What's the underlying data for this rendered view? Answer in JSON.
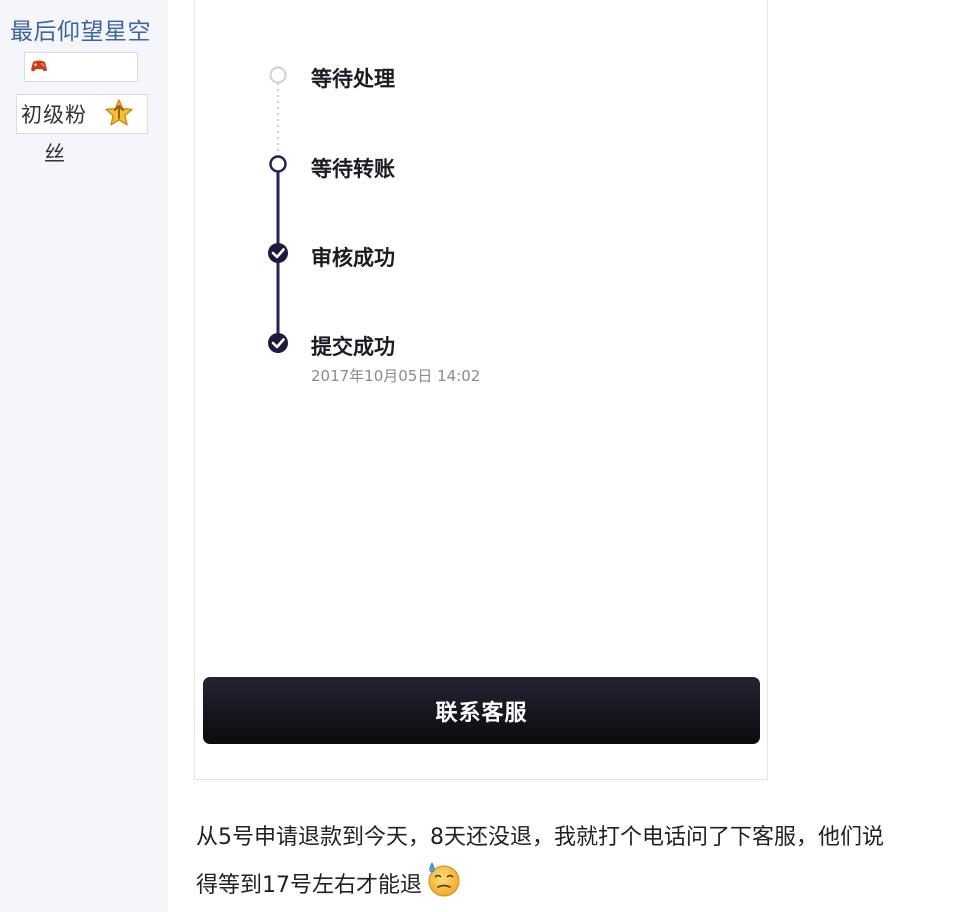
{
  "sidebar": {
    "username": "最后仰望星空",
    "level_label_line1": "初级粉",
    "level_label_line2": "丝"
  },
  "timeline": {
    "steps": [
      {
        "label": "等待处理",
        "status": "pending"
      },
      {
        "label": "等待转账",
        "status": "current"
      },
      {
        "label": "审核成功",
        "status": "done"
      },
      {
        "label": "提交成功",
        "status": "done",
        "time": "2017年10月05日 14:02"
      }
    ]
  },
  "actions": {
    "contact_label": "联系客服"
  },
  "post": {
    "text_line1": "从5号申请退款到今天，8天还没退，我就打个电话问了下客服，他们说",
    "text_line2": "得等到17号左右才能退"
  },
  "colors": {
    "username": "#3b64a8",
    "timeline_line": "#23205a",
    "button_bg": "#0a0a10"
  }
}
